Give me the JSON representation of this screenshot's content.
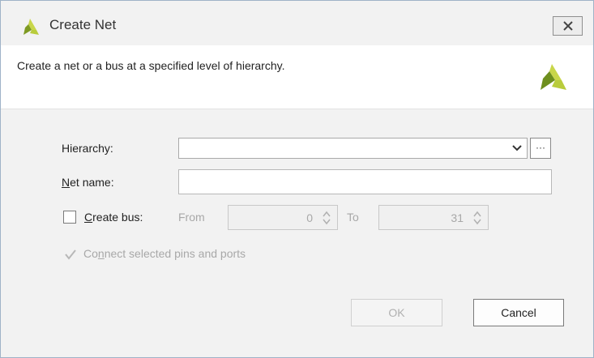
{
  "window": {
    "title": "Create Net",
    "logo_icon": "vivado-logo-icon",
    "close_icon": "close-icon"
  },
  "header": {
    "description": "Create a net or a bus at a specified level of hierarchy.",
    "logo_icon": "vivado-logo-icon"
  },
  "form": {
    "hierarchy": {
      "label": "Hierarchy:",
      "value": "",
      "browse_label": "···"
    },
    "net_name": {
      "label_mnemonic": "N",
      "label_rest": "et name:",
      "value": ""
    },
    "create_bus": {
      "label_mnemonic": "C",
      "label_rest": "reate bus:",
      "checked": false,
      "from_label": "From",
      "from_value": "0",
      "to_label": "To",
      "to_value": "31"
    },
    "connect": {
      "label_pre": "Co",
      "label_mnemonic": "n",
      "label_rest": "nect selected pins and ports",
      "checked": true,
      "enabled": false
    }
  },
  "buttons": {
    "ok": "OK",
    "cancel": "Cancel"
  },
  "colors": {
    "logo_light": "#c8d64a",
    "logo_dark": "#6e8f1e",
    "disabled_text": "#a8a8a8"
  }
}
